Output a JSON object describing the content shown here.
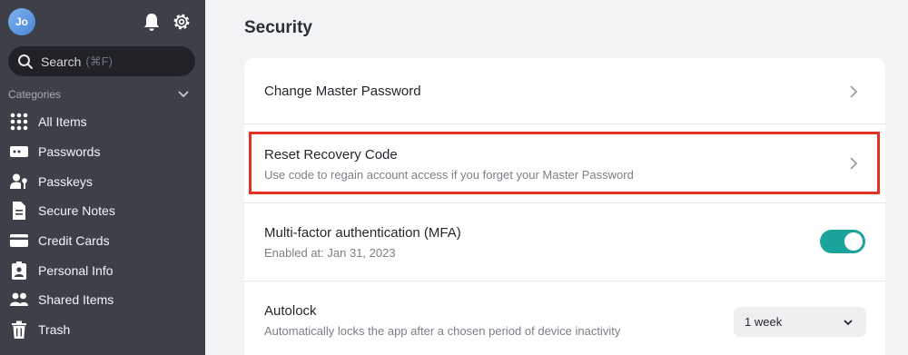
{
  "user": {
    "initials": "Jo"
  },
  "search": {
    "label": "Search",
    "shortcut": "(⌘F)"
  },
  "sidebar": {
    "categories_title": "Categories",
    "items": [
      {
        "label": "All Items",
        "icon": "grid-icon"
      },
      {
        "label": "Passwords",
        "icon": "password-icon"
      },
      {
        "label": "Passkeys",
        "icon": "passkey-icon"
      },
      {
        "label": "Secure Notes",
        "icon": "note-icon"
      },
      {
        "label": "Credit Cards",
        "icon": "credit-card-icon"
      },
      {
        "label": "Personal Info",
        "icon": "id-card-icon"
      },
      {
        "label": "Shared Items",
        "icon": "users-icon"
      },
      {
        "label": "Trash",
        "icon": "trash-icon"
      }
    ]
  },
  "main": {
    "title": "Security",
    "rows": {
      "change_password": {
        "title": "Change Master Password"
      },
      "recovery": {
        "title": "Reset Recovery Code",
        "subtitle": "Use code to regain account access if you forget your Master Password"
      },
      "mfa": {
        "title": "Multi-factor authentication (MFA)",
        "subtitle": "Enabled at: Jan 31, 2023",
        "enabled": true
      },
      "autolock": {
        "title": "Autolock",
        "subtitle": "Automatically locks the app after a chosen period of device inactivity",
        "value": "1 week"
      }
    }
  },
  "colors": {
    "sidebar": "#3d4048",
    "accent": "#1aa39a",
    "highlight": "#e53124"
  }
}
